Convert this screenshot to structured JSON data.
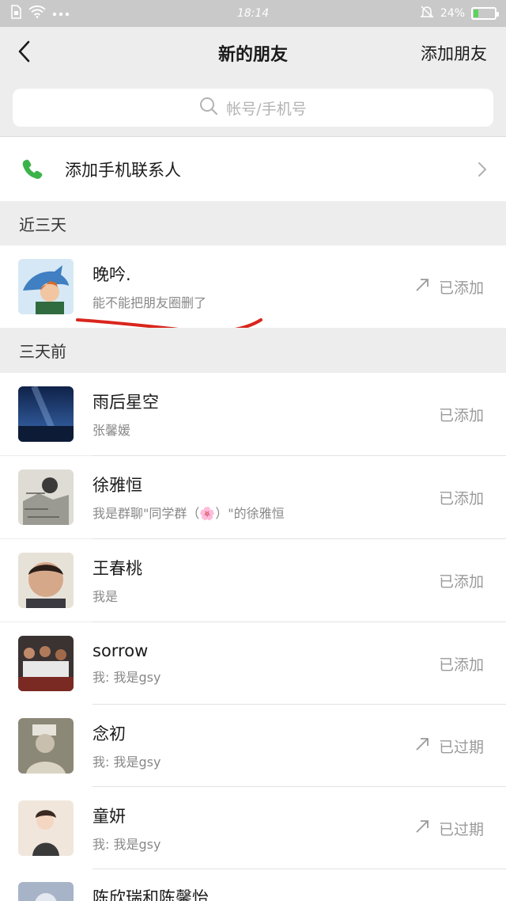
{
  "status_bar": {
    "time": "18:14",
    "battery_percent": "24%",
    "battery_level": 0.24,
    "icons": [
      "sim-card-icon",
      "wifi-icon",
      "more-dots-icon",
      "mute-bell-icon",
      "battery-icon"
    ]
  },
  "header": {
    "title": "新的朋友",
    "action": "添加朋友",
    "back_icon": "chevron-left-icon"
  },
  "search": {
    "placeholder": "帐号/手机号",
    "icon": "search-icon"
  },
  "add_contacts": {
    "label": "添加手机联系人",
    "icon": "phone-icon",
    "accent": "#3cb34a"
  },
  "sections": [
    {
      "title": "近三天",
      "items": [
        {
          "name": "晚吟.",
          "message": "能不能把朋友圈删了",
          "status": "已添加",
          "arrow": true,
          "avatar_color": "#4f8cc9"
        }
      ]
    },
    {
      "title": "三天前",
      "items": [
        {
          "name": "雨后星空",
          "message": "张馨媛",
          "status": "已添加",
          "arrow": false,
          "avatar_color": "#1f3f77"
        },
        {
          "name": "徐雅恒",
          "message": "我是群聊\"同学群（🌸）\"的徐雅恒",
          "status": "已添加",
          "arrow": false,
          "avatar_color": "#d9d9d2"
        },
        {
          "name": "王春桃",
          "message": "我是",
          "status": "已添加",
          "arrow": false,
          "avatar_color": "#c9a58a"
        },
        {
          "name": "sorrow",
          "message": "我: 我是gsy",
          "status": "已添加",
          "arrow": false,
          "avatar_color": "#3b3232"
        },
        {
          "name": "念初",
          "message": "我: 我是gsy",
          "status": "已过期",
          "arrow": true,
          "avatar_color": "#8c8877"
        },
        {
          "name": "童妍",
          "message": "我: 我是gsy",
          "status": "已过期",
          "arrow": true,
          "avatar_color": "#f0e6dc"
        },
        {
          "name": "陈欣瑞和陈馨怡",
          "message": "",
          "status": "",
          "arrow": false,
          "avatar_color": "#a7b4c8"
        }
      ]
    }
  ],
  "annotation_color": "#d9251c"
}
